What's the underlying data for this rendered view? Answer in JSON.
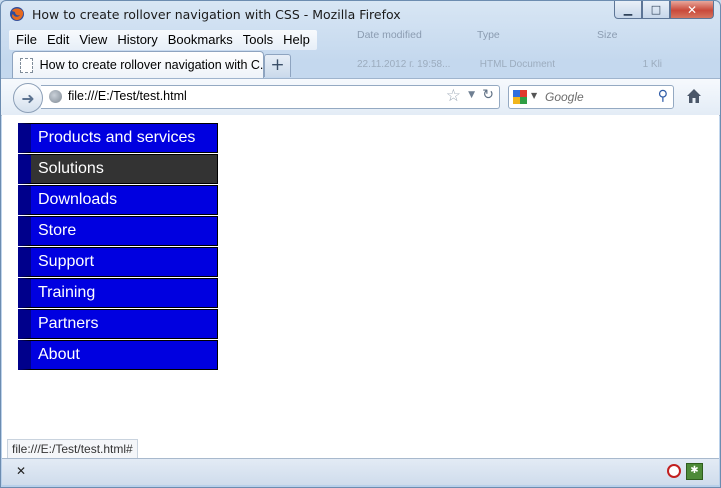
{
  "window": {
    "title": "How to create rollover navigation with CSS - Mozilla Firefox",
    "controls": {
      "minimize": "▁",
      "maximize": "□",
      "close": "✕"
    }
  },
  "menubar": {
    "items": [
      {
        "label": "File"
      },
      {
        "label": "Edit"
      },
      {
        "label": "View"
      },
      {
        "label": "History"
      },
      {
        "label": "Bookmarks"
      },
      {
        "label": "Tools"
      },
      {
        "label": "Help"
      }
    ]
  },
  "background_explorer": {
    "headers": [
      "Date modified",
      "Type",
      "Size"
    ],
    "row": [
      "22.11.2012 г. 19:58...",
      "HTML Document",
      "1 Kli"
    ]
  },
  "tabs": {
    "active_label": "How to create rollover navigation with C...",
    "new_tab_label": "+"
  },
  "navbar": {
    "url": "file:///E:/Test/test.html",
    "search_placeholder": "Google",
    "icons": [
      "back-arrow-icon",
      "globe-icon",
      "star-icon",
      "reload-icon",
      "google-icon",
      "magnifier-icon",
      "home-icon"
    ]
  },
  "page": {
    "nav_items": [
      {
        "label": "Products and services",
        "state": "normal"
      },
      {
        "label": "Solutions",
        "state": "hover"
      },
      {
        "label": "Downloads",
        "state": "normal"
      },
      {
        "label": "Store",
        "state": "normal"
      },
      {
        "label": "Support",
        "state": "normal"
      },
      {
        "label": "Training",
        "state": "normal"
      },
      {
        "label": "Partners",
        "state": "normal"
      },
      {
        "label": "About",
        "state": "normal"
      }
    ],
    "colors": {
      "link_bg": "#0000e0",
      "link_hover_bg": "#333333",
      "link_border_left": "#00008b"
    }
  },
  "statusbar": {
    "link_url": "file:///E:/Test/test.html#"
  },
  "addonbar": {
    "close_label": "✕"
  }
}
